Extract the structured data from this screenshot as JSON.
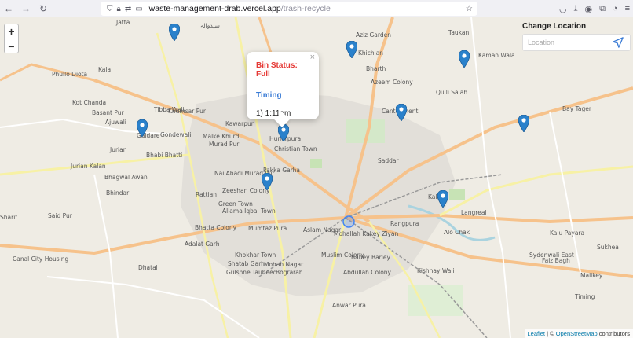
{
  "browser": {
    "url_host": "waste-management-drab.vercel.app",
    "url_path": "/trash-recycle"
  },
  "map": {
    "zoom_in_label": "+",
    "zoom_out_label": "−",
    "places": [
      {
        "name": "Jatta"
      },
      {
        "name": "سیدوالہ"
      },
      {
        "name": "Aziz Garden"
      },
      {
        "name": "Taukan"
      },
      {
        "name": "Kala"
      },
      {
        "name": "Phullo Diota"
      },
      {
        "name": "Khichian"
      },
      {
        "name": "Kaman Wala"
      },
      {
        "name": "Bharth"
      },
      {
        "name": "Azeem Colony"
      },
      {
        "name": "Kot Chanda"
      },
      {
        "name": "Basant Pur"
      },
      {
        "name": "Ajuwali"
      },
      {
        "name": "Tibba Wali"
      },
      {
        "name": "Khumsar Pur"
      },
      {
        "name": "Qulli Salah"
      },
      {
        "name": "Bay Tager"
      },
      {
        "name": "Kawarpur"
      },
      {
        "name": "Cantonment"
      },
      {
        "name": "Gondewali"
      },
      {
        "name": "Malke Khurd"
      },
      {
        "name": "Hunerpura"
      },
      {
        "name": "Gaidare"
      },
      {
        "name": "Murad Pur"
      },
      {
        "name": "Christian Town"
      },
      {
        "name": "Jurian"
      },
      {
        "name": "Bhabi Bhatti"
      },
      {
        "name": "Saddar"
      },
      {
        "name": "Jurian Kalan"
      },
      {
        "name": "Pakka Garha"
      },
      {
        "name": "Bhagwal Awan"
      },
      {
        "name": "Nai Abadi Murad Pur"
      },
      {
        "name": "Bhindar"
      },
      {
        "name": "Rattian"
      },
      {
        "name": "Zeeshan Colony"
      },
      {
        "name": "Kala"
      },
      {
        "name": "Green Town"
      },
      {
        "name": "Sharif"
      },
      {
        "name": "Allama Iqbal Town"
      },
      {
        "name": "Langreal"
      },
      {
        "name": "Said Pur"
      },
      {
        "name": "Rangpura"
      },
      {
        "name": "Bhatta Colony"
      },
      {
        "name": "Mumtaz Pura"
      },
      {
        "name": "Aslam Nagar"
      },
      {
        "name": "Alo Chak"
      },
      {
        "name": "Kalu Payara"
      },
      {
        "name": "Mohallah Kakey Ziyan"
      },
      {
        "name": "Adalat Garh"
      },
      {
        "name": "Canal City Housing"
      },
      {
        "name": "Khokhar Town"
      },
      {
        "name": "Babey Barley"
      },
      {
        "name": "Muslim Colony"
      },
      {
        "name": "Faiz Bagh"
      },
      {
        "name": "Sukhea"
      },
      {
        "name": "Sydenwali East"
      },
      {
        "name": "Dhatal"
      },
      {
        "name": "Shatab Garh"
      },
      {
        "name": "Mohan Nagar"
      },
      {
        "name": "Kishnay Wali"
      },
      {
        "name": "Gulshne Tauheed"
      },
      {
        "name": "Abdullah Colony"
      },
      {
        "name": "Bograrah"
      },
      {
        "name": "Malikey"
      },
      {
        "name": "Timing"
      },
      {
        "name": "Anwar Pura"
      }
    ]
  },
  "popup": {
    "close_label": "×",
    "status": "Bin Status: Full",
    "timing_title": "Timing",
    "time_entry": "1) 1:11am"
  },
  "location_panel": {
    "title": "Change Location",
    "placeholder": "Location"
  },
  "attribution": {
    "leaflet": "Leaflet",
    "separator": " | © ",
    "osm": "OpenStreetMap",
    "suffix": " contributors"
  },
  "colors": {
    "marker": "#2a81cb",
    "status_full": "#e53935",
    "timing": "#3a7bd5"
  }
}
